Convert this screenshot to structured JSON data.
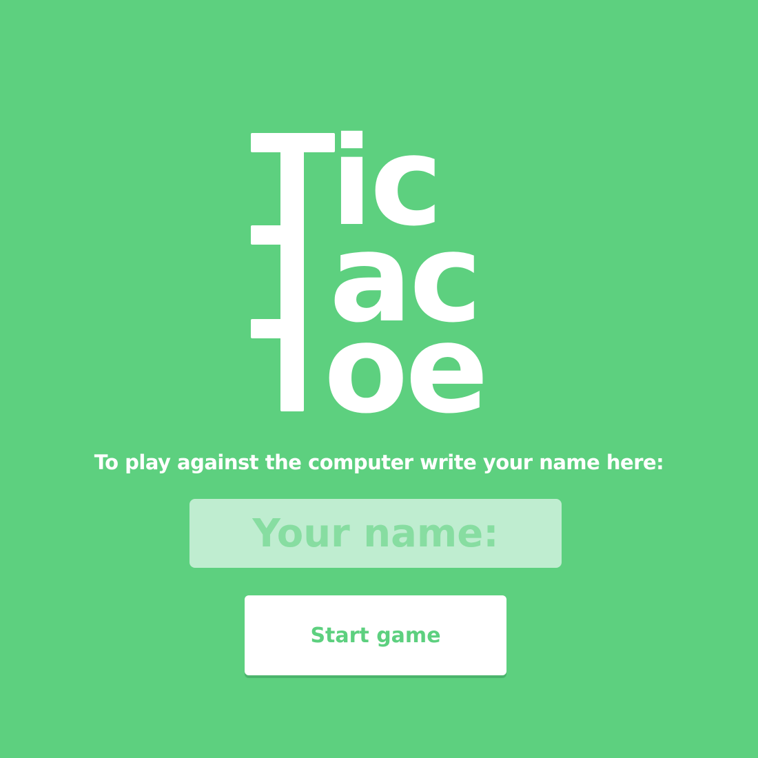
{
  "logo": {
    "line1": "ic",
    "line2": "ac",
    "line3": "oe"
  },
  "prompt": {
    "text": "To play against the computer write your name here:"
  },
  "name_field": {
    "placeholder": "Your name:",
    "value": ""
  },
  "start_button": {
    "label": "Start game"
  },
  "colors": {
    "background": "#5dd07f",
    "input_background": "#bfedd0",
    "placeholder": "#87dda1",
    "button_background": "#ffffff",
    "button_text": "#5dd07f"
  }
}
